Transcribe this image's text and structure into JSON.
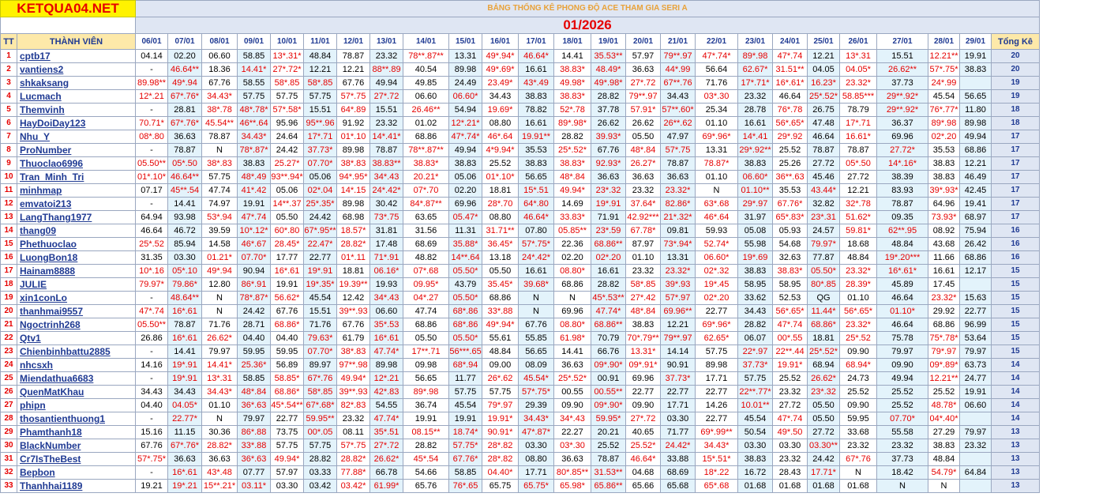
{
  "header": {
    "logo": "KETQUA04.NET",
    "subtitle": "BẢNG THỐNG KÊ PHONG ĐỘ ACE THAM GIA SERI A",
    "month": "01/2026",
    "col_tt": "TT",
    "col_member": "THÀNH VIÊN",
    "col_total": "Tổng Kê",
    "dates": [
      "06/01",
      "07/01",
      "08/01",
      "09/01",
      "10/01",
      "11/01",
      "12/01",
      "13/01",
      "14/01",
      "15/01",
      "16/01",
      "17/01",
      "18/01",
      "19/01",
      "20/01",
      "21/01",
      "22/01",
      "23/01",
      "24/01",
      "25/01",
      "26/01",
      "27/01",
      "28/01",
      "29/01"
    ]
  },
  "colors": {
    "logo_bg": "#fff200",
    "logo_text": "#e60000",
    "header_blue": "#1f3a93",
    "hit_red": "#e60000",
    "alt_fill": "#e3f3fb"
  },
  "rows": [
    {
      "tt": "1",
      "name": "cptb17",
      "cells": [
        "04.14",
        "02.20",
        "06.60",
        "58.85",
        "13*.31*",
        "48.84",
        "78.87",
        "23.32",
        "78**.87**",
        "13.31",
        "49*.94*",
        "46.64*",
        "14.41",
        "35.53**",
        "57.97",
        "79**.97",
        "47*.74*",
        "89*.98",
        "47*.74",
        "12.21",
        "13*.31",
        "15.51",
        "12.21**",
        "19.91"
      ],
      "total": "20"
    },
    {
      "tt": "2",
      "name": "vantiens2",
      "cells": [
        "-",
        "46.64**",
        "18.36",
        "14.41*",
        "27*.72*",
        "12.21",
        "12.21",
        "88**.89",
        "40.54",
        "89.98",
        "49*.69*",
        "16.61",
        "38.83*",
        "48.49*",
        "36.63",
        "44*.99",
        "56.64",
        "62.67*",
        "31.51**",
        "04.05",
        "04.05*",
        "26.62**",
        "57*.75*",
        "38.83"
      ],
      "total": "20"
    },
    {
      "tt": "3",
      "name": "shkaksang",
      "cells": [
        "89.98**",
        "49*.94",
        "67.76",
        "58.55",
        "58*.85",
        "58*.85",
        "67.76",
        "49.94",
        "49.85",
        "24.49",
        "23.49*",
        "43*.49",
        "49.98*",
        "49*.98*",
        "27*.72",
        "67**.76",
        "71.76",
        "17*.71*",
        "16*.61*",
        "16.23*",
        "23.32*",
        "37.73",
        "24*.99",
        ""
      ],
      "total": "19"
    },
    {
      "tt": "4",
      "name": "Lucmach",
      "cells": [
        "12*.21",
        "67*.76*",
        "34.43*",
        "57.75",
        "57.75",
        "57.75",
        "57*.75",
        "27*.72",
        "06.60",
        "06.60*",
        "34.43",
        "38.83",
        "38.83*",
        "28.82",
        "79**.97",
        "34.43",
        "03*.30",
        "23.32",
        "46.64",
        "25*.52*",
        "58.85***",
        "29**.92*",
        "45.54",
        "56.65"
      ],
      "total": "19"
    },
    {
      "tt": "5",
      "name": "Themvinh",
      "cells": [
        "-",
        "28.81",
        "38*.78",
        "48*.78*",
        "57*.58*",
        "15.51",
        "64*.89",
        "15.51",
        "26.46**",
        "54.94",
        "19.69*",
        "78.82",
        "52*.78",
        "37.78",
        "57.91*",
        "57**.60*",
        "25.34",
        "28.78",
        "76*.78",
        "26.75",
        "78.79",
        "29**.92*",
        "76*.77*",
        "11.80"
      ],
      "total": "18"
    },
    {
      "tt": "6",
      "name": "HayDoiDay123",
      "cells": [
        "70.71*",
        "67*.76*",
        "45.54**",
        "46**.64",
        "95.96",
        "95**.96",
        "91.92",
        "23.32",
        "01.02",
        "12*.21*",
        "08.80",
        "16.61",
        "89*.98*",
        "26.62",
        "26.62",
        "26**.62",
        "01.10",
        "16.61",
        "56*.65*",
        "47.48",
        "17*.71",
        "36.37",
        "89*.98",
        "89.98"
      ],
      "total": "18"
    },
    {
      "tt": "7",
      "name": "Nhu_Y",
      "cells": [
        "08*.80",
        "36.63",
        "78.87",
        "34.43*",
        "24.64",
        "17*.71",
        "01*.10",
        "14*.41*",
        "68.86",
        "47*.74*",
        "46*.64",
        "19.91**",
        "28.82",
        "39.93*",
        "05.50",
        "47.97",
        "69*.96*",
        "14*.41",
        "29*.92",
        "46.64",
        "16.61*",
        "69.96",
        "02*.20",
        "49.94"
      ],
      "total": "17"
    },
    {
      "tt": "8",
      "name": "ProNumber",
      "cells": [
        "-",
        "78.87",
        "N",
        "78*.87*",
        "24.42",
        "37.73*",
        "89.98",
        "78.87",
        "78**.87**",
        "49.94",
        "4*9.94*",
        "35.53",
        "25*.52*",
        "67.76",
        "48*.84",
        "57*.75",
        "13.31",
        "29*.92**",
        "25.52",
        "78.87",
        "78.87",
        "27.72*",
        "35.53",
        "68.86"
      ],
      "total": "17"
    },
    {
      "tt": "9",
      "name": "Thuoclao6996",
      "cells": [
        "05.50**",
        "05*.50",
        "38*.83",
        "38.83",
        "25.27*",
        "07.70*",
        "38*.83",
        "38.83**",
        "38.83*",
        "38.83",
        "25.52",
        "38.83",
        "38.83*",
        "92.93*",
        "26.27*",
        "78.87",
        "78.87*",
        "38.83",
        "25.26",
        "27.72",
        "05*.50",
        "14*.16*",
        "38.83",
        "12.21"
      ],
      "total": "17"
    },
    {
      "tt": "10",
      "name": "Tran_Minh_Tri",
      "cells": [
        "01*.10*",
        "46.64**",
        "57.75",
        "48*.49",
        "93**.94*",
        "05.06",
        "94*.95*",
        "34*.43",
        "20.21*",
        "05.06",
        "01*.10*",
        "56.65",
        "48*.84",
        "36.63",
        "36.63",
        "36.63",
        "01.10",
        "06.60*",
        "36**.63",
        "45.46",
        "27.72",
        "38.39",
        "38.83",
        "46.49"
      ],
      "total": "17"
    },
    {
      "tt": "11",
      "name": "minhmap",
      "cells": [
        "07.17",
        "45**.54",
        "47.74",
        "41*.42",
        "05.06",
        "02*.04",
        "14*.15",
        "24*.42*",
        "07*.70",
        "02.20",
        "18.81",
        "15*.51",
        "49.94*",
        "23*.32",
        "23.32",
        "23.32*",
        "N",
        "01.10**",
        "35.53",
        "43.44*",
        "12.21",
        "83.93",
        "39*.93*",
        "42.45"
      ],
      "total": "17"
    },
    {
      "tt": "12",
      "name": "emvatoi213",
      "cells": [
        "-",
        "14.41",
        "74.97",
        "19.91",
        "14**.37",
        "25*.35*",
        "89.98",
        "30.42",
        "84*.87**",
        "69.96",
        "28*.70",
        "64*.80",
        "14.69",
        "19*.91",
        "37.64*",
        "82.86*",
        "63*.68",
        "29*.97",
        "67.76*",
        "32.82",
        "32*.78",
        "78.87",
        "64.96",
        "19.41"
      ],
      "total": "17"
    },
    {
      "tt": "13",
      "name": "LangThang1977",
      "cells": [
        "64.94",
        "93.98",
        "53*.94",
        "47*.74",
        "05.50",
        "24.42",
        "68.98",
        "73*.75",
        "63.65",
        "05.47*",
        "08.80",
        "46.64*",
        "33.83*",
        "71.91",
        "42.92***",
        "21*.32*",
        "46*.64",
        "31.97",
        "65*.83*",
        "23*.31",
        "51.62*",
        "09.35",
        "73.93*",
        "68.97"
      ],
      "total": "17"
    },
    {
      "tt": "14",
      "name": "thang09",
      "cells": [
        "46.64",
        "46.72",
        "39.59",
        "10*.12*",
        "60*.80",
        "67*.95**",
        "18.57*",
        "31.81",
        "31.56",
        "11.31",
        "31.71**",
        "07.80",
        "05.85**",
        "23*.59",
        "67.78*",
        "09.81",
        "59.93",
        "05.08",
        "05.93",
        "24.57",
        "59.81*",
        "62**.95",
        "08.92",
        "75.94"
      ],
      "total": "16"
    },
    {
      "tt": "15",
      "name": "Phethuoclao",
      "cells": [
        "25*.52",
        "85.94",
        "14.58",
        "46*.67",
        "28.45*",
        "22.47*",
        "28.82*",
        "17.48",
        "68.69",
        "35.88*",
        "36.45*",
        "57*.75*",
        "22.36",
        "68.86**",
        "87.97",
        "73*.94*",
        "52.74*",
        "55.98",
        "54.68",
        "79.97*",
        "18.68",
        "48.84",
        "43.68",
        "26.42"
      ],
      "total": "16"
    },
    {
      "tt": "16",
      "name": "LuongBon18",
      "cells": [
        "31.35",
        "03.30",
        "01.21*",
        "07.70*",
        "17.77",
        "22.77",
        "01*.11",
        "71*.91",
        "48.82",
        "14**.64",
        "13.18",
        "24*.42*",
        "02.20",
        "02*.20",
        "01.10",
        "13.31",
        "06.60*",
        "19*.69",
        "32.63",
        "77.87",
        "48.84",
        "19*.20***",
        "11.66",
        "68.86"
      ],
      "total": "16"
    },
    {
      "tt": "17",
      "name": "Hainam8888",
      "cells": [
        "10*.16",
        "05*.10",
        "49*.94",
        "90.94",
        "16*.61",
        "19*.91",
        "18.81",
        "06.16*",
        "07*.68",
        "05.50*",
        "05.50",
        "16.61",
        "08.80*",
        "16.61",
        "23.32",
        "23.32*",
        "02*.32",
        "38.83",
        "38.83*",
        "05.50*",
        "23.32*",
        "16*.61*",
        "16.61",
        "12.17"
      ],
      "total": "15"
    },
    {
      "tt": "18",
      "name": "JULIE",
      "cells": [
        "79.97*",
        "79.86*",
        "12.80",
        "86*.91",
        "19.91",
        "19*.35*",
        "19.39**",
        "19.93",
        "09.95*",
        "43.79",
        "35.45*",
        "39.68*",
        "68.86",
        "28.82",
        "58*.85",
        "39*.93",
        "19*.45",
        "58.95",
        "58.95",
        "80*.85",
        "28.39*",
        "45.89",
        "17.45",
        ""
      ],
      "total": "15"
    },
    {
      "tt": "19",
      "name": "xin1conLo",
      "cells": [
        "-",
        "48.64**",
        "N",
        "78*.87*",
        "56.62*",
        "45.54",
        "12.42",
        "34*.43",
        "04*.27",
        "05.50*",
        "68.86",
        "N",
        "N",
        "45*.53**",
        "27*.42",
        "57*.97",
        "02*.20",
        "33.62",
        "52.53",
        "QG",
        "01.10",
        "46.64",
        "23.32*",
        "15.63"
      ],
      "total": "15"
    },
    {
      "tt": "20",
      "name": "thanhmai9557",
      "cells": [
        "47*.74",
        "16*.61",
        "N",
        "24.42",
        "67.76",
        "15.51",
        "39**.93",
        "06.60",
        "47.74",
        "68*.86",
        "33*.88",
        "N",
        "69.96",
        "47.74*",
        "48*.84",
        "69.96**",
        "22.77",
        "34.43",
        "56*.65*",
        "11.44*",
        "56*.65*",
        "01.10*",
        "29.92",
        "22.77"
      ],
      "total": "15"
    },
    {
      "tt": "21",
      "name": "Ngoctrinh268",
      "cells": [
        "05.50**",
        "78.87",
        "71.76",
        "28.71",
        "68.86*",
        "71.76",
        "67.76",
        "35*.53",
        "68.86",
        "68*.86",
        "49*.94*",
        "67.76",
        "08.80*",
        "68.86**",
        "38.83",
        "12.21",
        "69*.96*",
        "28.82",
        "47*.74",
        "68.86*",
        "23.32*",
        "46.64",
        "68.86",
        "96.99"
      ],
      "total": "15"
    },
    {
      "tt": "22",
      "name": "Qtv1",
      "cells": [
        "26.86",
        "16*.61",
        "26.62*",
        "04.40",
        "04.40",
        "79.63*",
        "61.79",
        "16*.61",
        "05.50",
        "05.50*",
        "55.61",
        "55.85",
        "61.98*",
        "70.79",
        "70*.79**",
        "79**.97",
        "62.65*",
        "06.07",
        "00*.55",
        "18.81",
        "25*.52",
        "75.78",
        "75*.78*",
        "53.64"
      ],
      "total": "15"
    },
    {
      "tt": "23",
      "name": "Chienbinhbattu2885",
      "cells": [
        "-",
        "14.41",
        "79.97",
        "59.95",
        "59.95",
        "07.70*",
        "38*.83",
        "47.74*",
        "17**.71",
        "56***.65",
        "48.84",
        "56.65",
        "14.41",
        "66.76",
        "13.31*",
        "14.14",
        "57.75",
        "22*.97",
        "22**.44",
        "25*.52*",
        "09.90",
        "79.97",
        "79*.97",
        "79.97"
      ],
      "total": "15"
    },
    {
      "tt": "24",
      "name": "nhcsxh",
      "cells": [
        "14.16",
        "19*.91",
        "14.41*",
        "25.36*",
        "56.89",
        "89.97",
        "97**.98",
        "89.98",
        "09.98",
        "68*.94",
        "09.00",
        "08.09",
        "36.63",
        "09*.90*",
        "09*.91*",
        "90.91",
        "89.98",
        "37.73*",
        "19.91*",
        "68.94",
        "68.94*",
        "09.90",
        "09*.89*",
        "63.73"
      ],
      "total": "14"
    },
    {
      "tt": "25",
      "name": "Miendathua6683",
      "cells": [
        "-",
        "19*.91",
        "13*.31",
        "58.85",
        "58.85*",
        "67*.76",
        "49.94*",
        "12*.21",
        "56.65",
        "11.77",
        "26*.62",
        "45.54*",
        "25*.52*",
        "00.91",
        "69.96",
        "37.73*",
        "17.71",
        "57.75",
        "25.52",
        "26.62*",
        "24.73",
        "49.94",
        "12.21**",
        "24.77"
      ],
      "total": "14"
    },
    {
      "tt": "26",
      "name": "QuenMatKhau",
      "cells": [
        "34.43",
        "34.43",
        "34.43*",
        "48*.84",
        "68.86*",
        "58*.85",
        "39**.93",
        "42*.83",
        "89*.98",
        "57.75",
        "57.75",
        "57*.75*",
        "00.55",
        "00.55**",
        "22.77",
        "22.77",
        "22.77",
        "22**.77*",
        "23.32",
        "23*.32",
        "25.52",
        "25.52",
        "25.52",
        "19.91"
      ],
      "total": "14"
    },
    {
      "tt": "27",
      "name": "phipn",
      "cells": [
        "04.40",
        "04.05*",
        "01.10",
        "36*.63",
        "45*.54**",
        "67*.68*",
        "82*.83",
        "54.55",
        "36.74",
        "45.54",
        "79*.97",
        "29.39",
        "09.90",
        "09*.90*",
        "09.90",
        "17.71",
        "14.26",
        "10.01**",
        "27.72",
        "05.50",
        "09.90",
        "25.52",
        "48.78*",
        "06.60"
      ],
      "total": "14"
    },
    {
      "tt": "28",
      "name": "thosantienthuong1",
      "cells": [
        "-",
        "22.77*",
        "N",
        "79.97",
        "22.77",
        "59.95**",
        "23.32",
        "47.74*",
        "19.91",
        "19.91",
        "19.91*",
        "34.43*",
        "34*.43",
        "59.95*",
        "27*.72",
        "03.30",
        "22.77",
        "45.54",
        "47*.74",
        "05.50",
        "59.95",
        "07.70*",
        "04*.40*",
        ""
      ],
      "total": "14"
    },
    {
      "tt": "29",
      "name": "Phamthanh18",
      "cells": [
        "15.16",
        "11.15",
        "30.36",
        "86*.88",
        "73.75",
        "00*.05",
        "08.11",
        "35*.51",
        "08.15**",
        "18.74*",
        "90.91*",
        "47*.87*",
        "22.27",
        "20.21",
        "40.65",
        "71.77",
        "69*.99**",
        "50.54",
        "49*.50",
        "27.72",
        "33.68",
        "55.58",
        "27.29",
        "79.97"
      ],
      "total": "13"
    },
    {
      "tt": "30",
      "name": "BlackNumber",
      "cells": [
        "67.76",
        "67*.76*",
        "28.82*",
        "33*.88",
        "57.75",
        "57.75",
        "57*.75",
        "27*.72",
        "28.82",
        "57.75*",
        "28*.82",
        "03.30",
        "03*.30",
        "25.52",
        "25.52*",
        "24.42*",
        "34.43*",
        "03.30",
        "03.30",
        "03.30**",
        "23.32",
        "23.32",
        "38.83",
        "23.32"
      ],
      "total": "13"
    },
    {
      "tt": "31",
      "name": "Cr7IsTheBest",
      "cells": [
        "57*.75*",
        "36.63",
        "36.63",
        "36*.63",
        "49.94*",
        "28.82",
        "28.82*",
        "26.62*",
        "45*.54",
        "67.76*",
        "28*.82",
        "08.80",
        "36.63",
        "78.87",
        "46.64*",
        "33.88",
        "15*.51*",
        "38.83",
        "23.32",
        "24.42",
        "67*.76",
        "37.73",
        "48.84",
        ""
      ],
      "total": "13"
    },
    {
      "tt": "32",
      "name": "Bepbon",
      "cells": [
        "-",
        "16*.61",
        "43*.48",
        "07.77",
        "57.97",
        "03.33",
        "77.88*",
        "66.78",
        "54.66",
        "58.85",
        "04.40*",
        "17.71",
        "80*.85**",
        "31.53**",
        "04.68",
        "68.69",
        "18*.22",
        "16.72",
        "28.43",
        "17.71*",
        "N",
        "18.42",
        "54.79*",
        "64.84"
      ],
      "total": "13"
    },
    {
      "tt": "33",
      "name": "Thanhhai1189",
      "cells": [
        "19.21",
        "19*.21",
        "15**.21*",
        "03.11*",
        "03.30",
        "03.42",
        "03.42*",
        "61.99*",
        "65.76",
        "76*.65",
        "65.75",
        "65.75*",
        "65.98*",
        "65.86**",
        "65.66",
        "65.68",
        "65*.68",
        "01.68",
        "01.68",
        "01.68",
        "01.68",
        "N",
        "N",
        ""
      ],
      "total": "13"
    }
  ]
}
